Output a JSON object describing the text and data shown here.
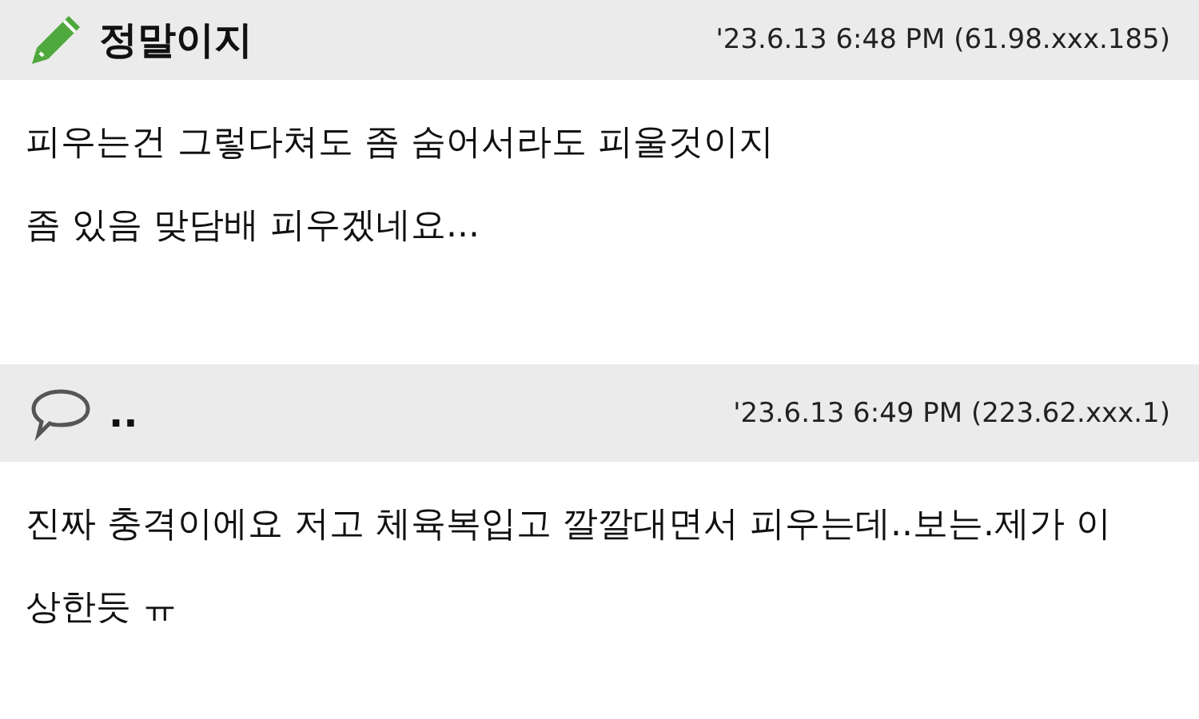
{
  "comments": [
    {
      "kind": "edited",
      "author": "정말이지",
      "meta": "'23.6.13 6:48 PM (61.98.xxx.185)",
      "lines": [
        "피우는건 그렇다쳐도 좀 숨어서라도 피울것이지",
        "좀 있음 맞담배 피우겠네요..."
      ]
    },
    {
      "kind": "reply",
      "author": "..",
      "meta": "'23.6.13 6:49 PM (223.62.xxx.1)",
      "lines": [
        "진짜 충격이에요 저고 체육복입고 깔깔대면서 피우는데..보는.제가 이",
        "상한듯 ㅠ"
      ]
    }
  ]
}
